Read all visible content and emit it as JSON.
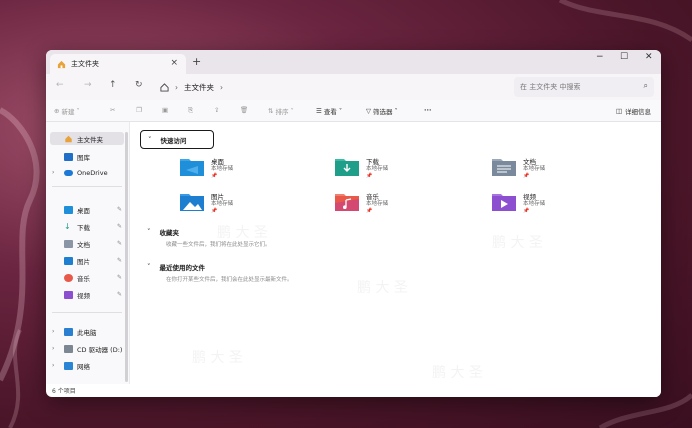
{
  "window": {
    "tab_title": "主文件夹",
    "tab_close": "×",
    "new_tab": "+",
    "minimize": "−",
    "maximize": "☐",
    "close": "✕"
  },
  "nav": {
    "back": "←",
    "forward": "→",
    "up": "↑",
    "refresh": "↻",
    "breadcrumb": [
      "主文件夹"
    ],
    "search_placeholder": "在 主文件夹 中搜索"
  },
  "toolbar": {
    "new_label": "新建",
    "sort_label": "排序",
    "view_label": "查看",
    "filter_label": "筛选器",
    "more_label": "···",
    "details_label": "详细信息"
  },
  "sidebar": {
    "top_items": [
      {
        "label": "主文件夹",
        "icon": "home-icon",
        "selected": true
      },
      {
        "label": "图库",
        "icon": "gallery-icon",
        "selected": false
      },
      {
        "label": "OneDrive",
        "icon": "onedrive-icon",
        "selected": false
      }
    ],
    "pinned_items": [
      {
        "label": "桌面",
        "icon": "desktop-folder-icon"
      },
      {
        "label": "下载",
        "icon": "download-icon"
      },
      {
        "label": "文档",
        "icon": "documents-icon"
      },
      {
        "label": "图片",
        "icon": "pictures-icon"
      },
      {
        "label": "音乐",
        "icon": "music-icon"
      },
      {
        "label": "视频",
        "icon": "videos-icon"
      }
    ],
    "bottom_items": [
      {
        "label": "此电脑",
        "icon": "computer-icon"
      },
      {
        "label": "CD 驱动器 (D:)",
        "icon": "cd-drive-icon"
      },
      {
        "label": "网络",
        "icon": "network-icon"
      }
    ],
    "status": "6 个项目"
  },
  "content": {
    "quick_access_title": "快速访问",
    "folders": [
      {
        "name": "桌面",
        "sub": "本地存储",
        "icon": "desktop-folder-icon",
        "color": "#1e8fd8"
      },
      {
        "name": "下载",
        "sub": "本地存储",
        "icon": "download-folder-icon",
        "color": "#1f9e8a"
      },
      {
        "name": "文档",
        "sub": "本地存储",
        "icon": "documents-folder-icon",
        "color": "#7a8a9c"
      },
      {
        "name": "图片",
        "sub": "本地存储",
        "icon": "pictures-folder-icon",
        "color": "#1e7fd0"
      },
      {
        "name": "音乐",
        "sub": "本地存储",
        "icon": "music-folder-icon",
        "color": "#e8594a"
      },
      {
        "name": "视频",
        "sub": "本地存储",
        "icon": "videos-folder-icon",
        "color": "#8b4fd0"
      }
    ],
    "pin_glyph": "📌",
    "favorites_title": "收藏夹",
    "favorites_hint": "收藏一些文件后，我们将在此处显示它们。",
    "recent_title": "最近使用的文件",
    "recent_hint": "在你打开某些文件后，我们会在此处显示最新文件。"
  },
  "watermark": "鹏 大 圣"
}
